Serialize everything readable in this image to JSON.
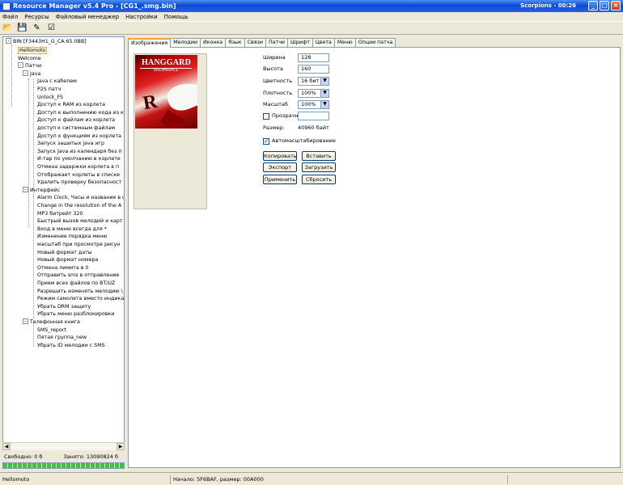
{
  "window": {
    "title": "Resource Manager v5.4 Pro - [CG1_.smg.bin]",
    "user_time": "Scorpions - 00:26",
    "minimize": "_",
    "maximize": "□",
    "close": "×"
  },
  "menu": [
    "Файл",
    "Ресурсы",
    "Файловый менеджер",
    "Настройки",
    "Помощь"
  ],
  "toolbar": [
    {
      "name": "open-icon",
      "glyph": "📂"
    },
    {
      "name": "save-icon",
      "glyph": "💾"
    },
    {
      "name": "edit-icon",
      "glyph": "✎"
    },
    {
      "name": "check-icon",
      "glyph": "☑"
    }
  ],
  "tree": {
    "root": "BIN [F3443H1_G_CA.65.0BB]",
    "items": [
      {
        "label": "Hellomoto",
        "level": 1,
        "selected": true
      },
      {
        "label": "Welcome",
        "level": 1
      },
      {
        "label": "Патчи",
        "level": 1,
        "expanded": true
      },
      {
        "label": "Java",
        "level": 2,
        "expanded": true
      },
      {
        "label": "Java с кабелем",
        "level": 3
      },
      {
        "label": "P2S патч",
        "level": 3
      },
      {
        "label": "Unlock_FS",
        "level": 3
      },
      {
        "label": "Доступ к RAM из корлета",
        "level": 3
      },
      {
        "label": "Доступ к выполнению кода из к",
        "level": 3
      },
      {
        "label": "Доступ к файлам из корлета",
        "level": 3
      },
      {
        "label": "доступ к системным файлам",
        "level": 3
      },
      {
        "label": "Доступ к функциям из корлета",
        "level": 3
      },
      {
        "label": "Запуск зашитых java игр",
        "level": 3
      },
      {
        "label": "Запуск Java из календаря без п",
        "level": 3
      },
      {
        "label": "И-тар по умолчанию в корлете",
        "level": 3
      },
      {
        "label": "Отмена задержки корлета в п",
        "level": 3
      },
      {
        "label": "Отображает корлеты в списке",
        "level": 3
      },
      {
        "label": "Удалить проверку безопасност",
        "level": 3
      },
      {
        "label": "Интерфейс",
        "level": 2,
        "expanded": true
      },
      {
        "label": "Alarm Clock, Часы и название в ι",
        "level": 3
      },
      {
        "label": "Change in the resolution of the A",
        "level": 3
      },
      {
        "label": "MP3 битрейт 320",
        "level": 3
      },
      {
        "label": "Быстрый вызов мелодий и карт",
        "level": 3
      },
      {
        "label": "Вход в меню всегда для *",
        "level": 3
      },
      {
        "label": "Изменение порядка меню",
        "level": 3
      },
      {
        "label": "масштаб при просмотре рисун",
        "level": 3
      },
      {
        "label": "Новый формат даты",
        "level": 3
      },
      {
        "label": "Новый формат номера",
        "level": 3
      },
      {
        "label": "Отмена лимита в 0",
        "level": 3
      },
      {
        "label": "Отправить sms в отправление",
        "level": 3
      },
      {
        "label": "Прием всех файлов по BT/UZ",
        "level": 3
      },
      {
        "label": "Разрешить изменять мелодию \\",
        "level": 3
      },
      {
        "label": "Режим самолета вместо индика",
        "level": 3
      },
      {
        "label": "Убрать DRM защиту",
        "level": 3
      },
      {
        "label": "Убрать меню разблокировки",
        "level": 3
      },
      {
        "label": "Телефонная книга",
        "level": 2,
        "expanded": true
      },
      {
        "label": "SMS_report",
        "level": 3
      },
      {
        "label": "Пятая группа_new",
        "level": 3
      },
      {
        "label": "Убрать ID мелодии с SMS",
        "level": 3
      }
    ]
  },
  "memory": {
    "free": "Свободно: 0 б",
    "used": "Занято: 13090824 б",
    "progress": 1.0
  },
  "tabs": [
    "Изображения",
    "Мелодии",
    "Иконка",
    "Язык",
    "Связи",
    "Патчи",
    "Шрифт",
    "Цвета",
    "Меню",
    "Опции патча"
  ],
  "image": {
    "poster_title": "HANGGARD",
    "poster_subtitle": "DREAMSPACE",
    "poster_letter": "R"
  },
  "form": {
    "width_label": "Ширина",
    "width_value": "128",
    "height_label": "Высота",
    "height_value": "160",
    "color_label": "Цветность",
    "color_value": "16 бит",
    "transparency_label": "Плотность",
    "transparency_value": "100%",
    "scale_label": "Масштаб",
    "scale_value": "100%",
    "transparent_checkbox": "Прозрачн",
    "transparent_value": "",
    "size_label": "Размер:",
    "size_value": "40960 байт",
    "autoscale_label": "Автомасштабирование",
    "copy_button": "Копировать",
    "paste_button": "Вставить",
    "export_button": "Экспорт",
    "load_button": "Загрузить",
    "apply_button": "Применить",
    "reset_button": "Сбросить"
  },
  "status": {
    "left": "Hellomoto",
    "right": "Начало: 5F6BAF, размер: 00A000"
  }
}
